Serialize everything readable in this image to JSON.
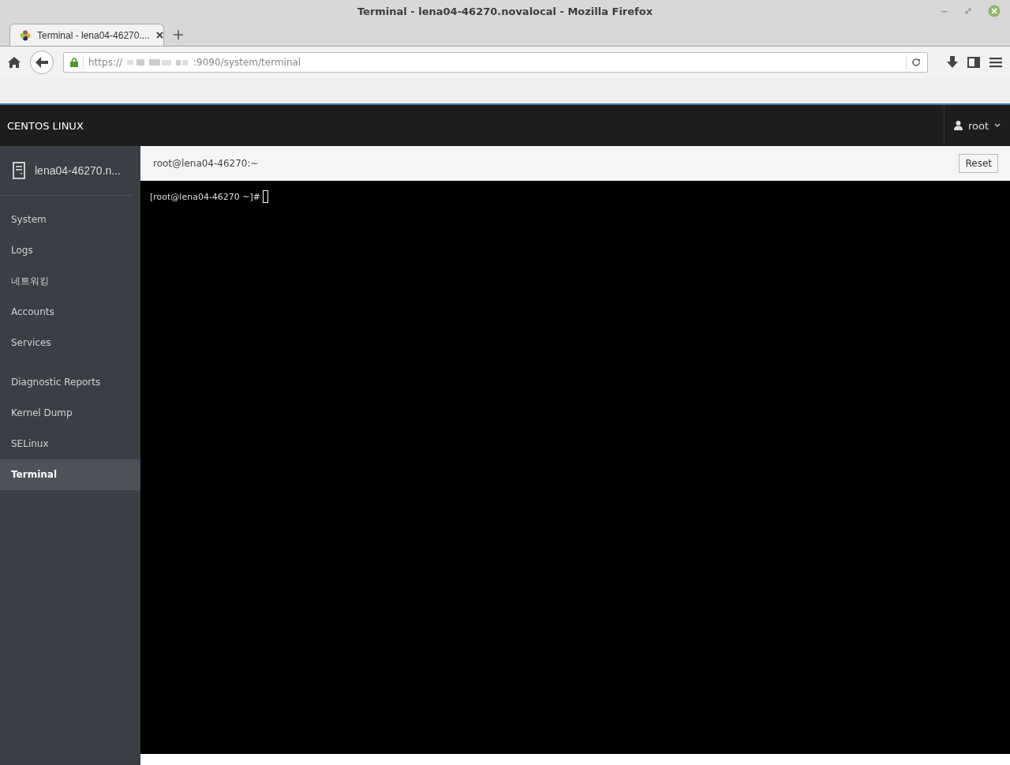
{
  "window": {
    "title": "Terminal - lena04-46270.novalocal - Mozilla Firefox"
  },
  "tabs": [
    {
      "label": "Terminal - lena04-46270....",
      "selected": true
    }
  ],
  "address_bar": {
    "scheme": "https://",
    "path": ":9090/system/terminal"
  },
  "header": {
    "brand": "CENTOS LINUX",
    "user": "root"
  },
  "sidebar": {
    "host": "lena04-46270.n...",
    "groups": [
      [
        {
          "label": "System",
          "selected": false
        },
        {
          "label": "Logs",
          "selected": false
        },
        {
          "label": "네트워킹",
          "selected": false
        },
        {
          "label": "Accounts",
          "selected": false
        },
        {
          "label": "Services",
          "selected": false
        }
      ],
      [
        {
          "label": "Diagnostic Reports",
          "selected": false
        },
        {
          "label": "Kernel Dump",
          "selected": false
        },
        {
          "label": "SELinux",
          "selected": false
        },
        {
          "label": "Terminal",
          "selected": true
        }
      ]
    ]
  },
  "terminal": {
    "title": "root@lena04-46270:~",
    "reset": "Reset",
    "prompt": "[root@lena04-46270 ~]#"
  }
}
